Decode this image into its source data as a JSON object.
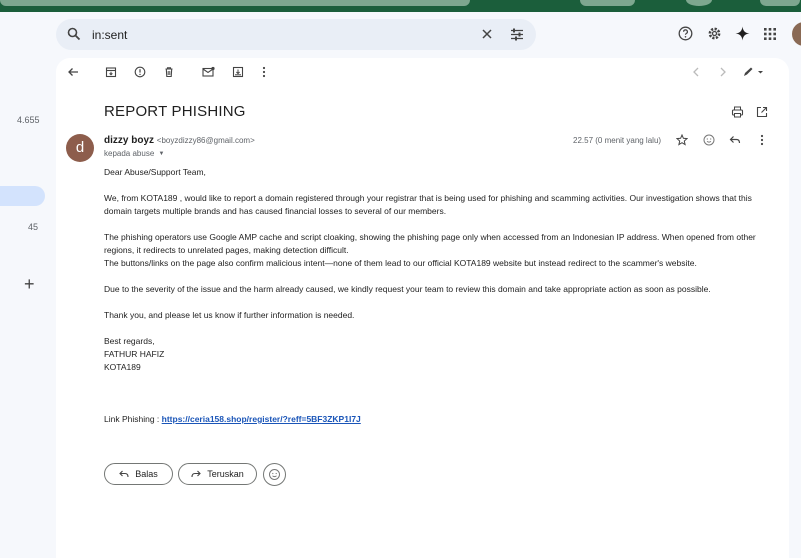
{
  "nav": {
    "counts": [
      "4.655",
      "45"
    ]
  },
  "search": {
    "value": "in:sent"
  },
  "email": {
    "subject": "REPORT PHISHING",
    "avatar_letter": "d",
    "sender_name": "dizzy boyz",
    "sender_email": "<boyzdizzy86@gmail.com>",
    "to_label": "kepada abuse",
    "time": "22.57 (0 menit yang lalu)",
    "body": {
      "greeting": "Dear Abuse/Support Team,",
      "p1": "We, from KOTA189 , would like to report a domain registered through your registrar that is being used for phishing and scamming activities. Our investigation shows that this domain targets multiple brands and has caused financial losses to several of our members.",
      "p2a": "The phishing operators use Google AMP cache and script cloaking, showing the phishing page only when accessed from an Indonesian IP address. When opened from other regions, it redirects to unrelated pages, making detection difficult.",
      "p2b": "The buttons/links on the page also confirm malicious intent—none of them lead to our official KOTA189  website but instead redirect to the scammer's website.",
      "p3": "Due to the severity of the issue and the harm already caused, we kindly request your team to review this domain and take appropriate action as soon as possible.",
      "p4": "Thank you, and please let us know if further information is needed.",
      "sig1": "Best regards,",
      "sig2": "FATHUR HAFIZ",
      "sig3": "KOTA189",
      "link_label": "Link Phishing : ",
      "link_url": "https://ceria158.shop/register/?reff=5BF3ZKP1I7J"
    }
  },
  "actions": {
    "reply": "Balas",
    "forward": "Teruskan"
  },
  "colors": {
    "top_bar": "#1b5e3b",
    "search_bg": "#e9eef6",
    "selected_nav": "#d3e3fd",
    "link": "#1a55b8"
  }
}
